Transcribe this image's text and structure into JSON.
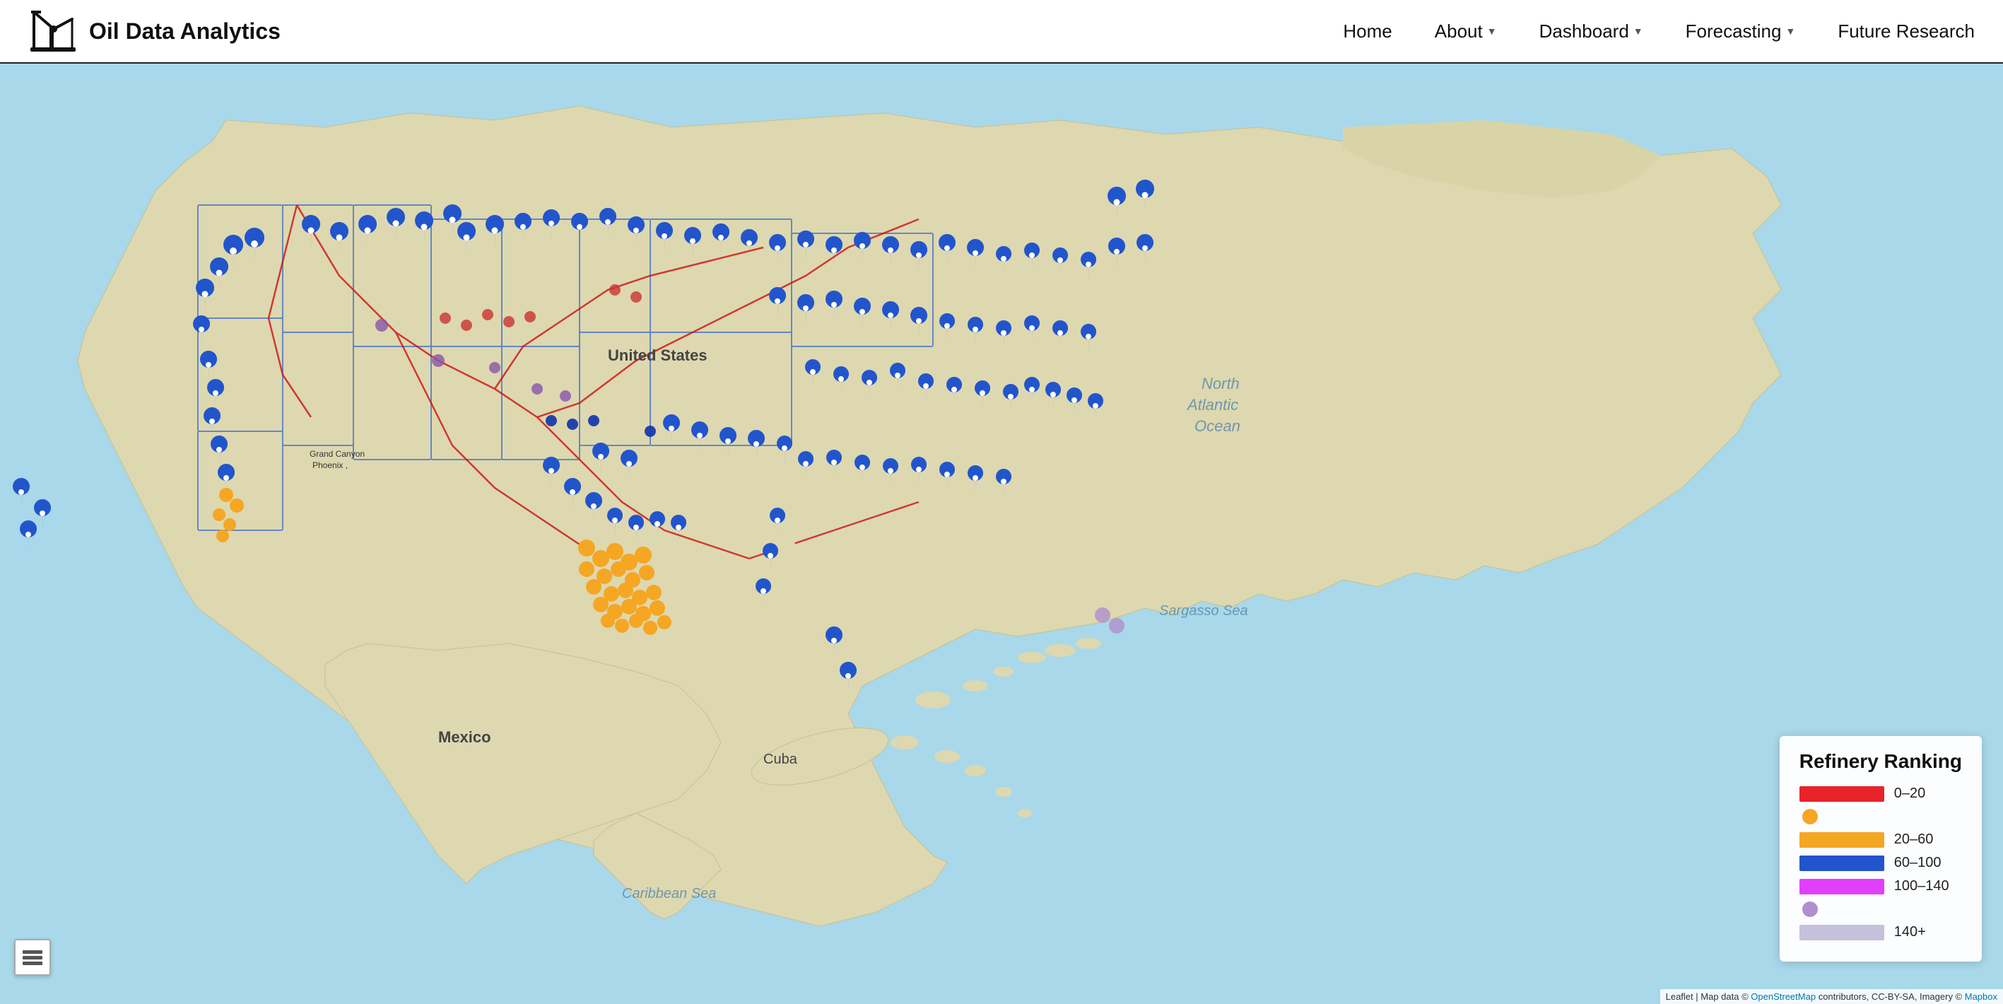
{
  "brand": {
    "title": "Oil Data Analytics"
  },
  "nav": {
    "home": "Home",
    "about": "About",
    "dashboard": "Dashboard",
    "forecasting": "Forecasting",
    "future_research": "Future Research"
  },
  "legend": {
    "title": "Refinery Ranking",
    "items": [
      {
        "type": "bar",
        "color": "#e8232a",
        "label": "0–20"
      },
      {
        "type": "dot",
        "color": "#f5a623",
        "label": ""
      },
      {
        "type": "bar",
        "color": "#f5a623",
        "label": "20–60"
      },
      {
        "type": "bar",
        "color": "#2255cc",
        "label": "60–100"
      },
      {
        "type": "bar",
        "color": "#e040fb",
        "label": "100–140"
      },
      {
        "type": "dot",
        "color": "#b0b0c8",
        "label": ""
      },
      {
        "type": "bar",
        "color": "#c5c0dc",
        "label": "140+"
      }
    ]
  },
  "map_labels": {
    "grand_canyon_phoenix": "Grand Canyon\nPhoenix ,",
    "united_states": "United States",
    "mexico": "Mexico",
    "cuba": "Cuba",
    "north_atlantic_ocean": "North Atlantic Ocean",
    "sargasso_sea": "Sargasso Sea",
    "caribbean_sea": "Caribbean Sea"
  },
  "attribution": "Leaflet | Map data © OpenStreetMap contributors, CC-BY-SA, Imagery © Mapbox"
}
